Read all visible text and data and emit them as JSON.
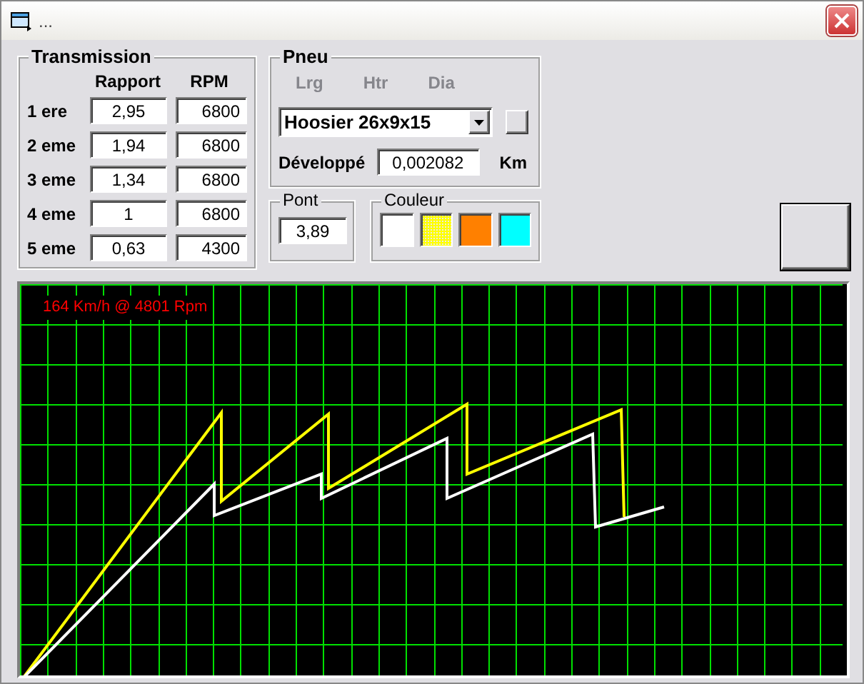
{
  "window": {
    "title": "..."
  },
  "transmission": {
    "title": "Transmission",
    "columns": [
      "Rapport",
      "RPM"
    ],
    "gears": [
      {
        "label": "1 ere",
        "rapport": "2,95",
        "rpm": "6800"
      },
      {
        "label": "2 eme",
        "rapport": "1,94",
        "rpm": "6800"
      },
      {
        "label": "3 eme",
        "rapport": "1,34",
        "rpm": "6800"
      },
      {
        "label": "4 eme",
        "rapport": "1",
        "rpm": "6800"
      },
      {
        "label": "5 eme",
        "rapport": "0,63",
        "rpm": "4300"
      }
    ]
  },
  "pneu": {
    "title": "Pneu",
    "headers": [
      {
        "label": "Lrg",
        "disabled": true
      },
      {
        "label": "Htr",
        "disabled": true
      },
      {
        "label": "Dia",
        "disabled": true
      }
    ],
    "tire": "Hoosier 26x9x15",
    "developpe_label": "Développé",
    "developpe": "0,002082",
    "unit": "Km"
  },
  "pont": {
    "title": "Pont",
    "value": "3,89"
  },
  "couleur": {
    "title": "Couleur",
    "swatches": [
      {
        "kind": "solid",
        "color": "#ffffff"
      },
      {
        "kind": "dither",
        "color": "#ffff00"
      },
      {
        "kind": "solid",
        "color": "#ff8000"
      },
      {
        "kind": "solid",
        "color": "#00ffff"
      }
    ]
  },
  "graph": {
    "readout": "164 Km/h @ 4801 Rpm"
  }
}
